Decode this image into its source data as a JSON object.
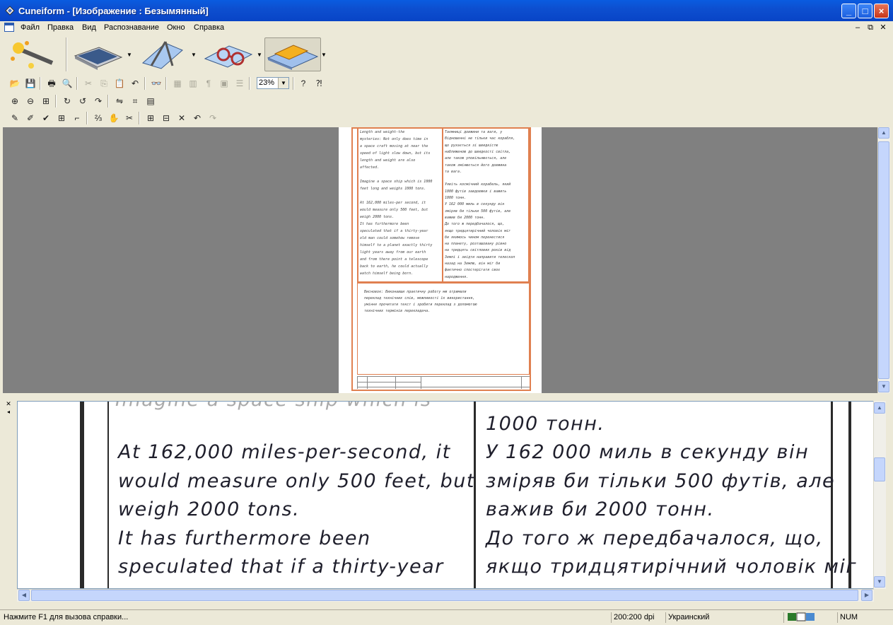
{
  "window": {
    "title": "Cuneiform - [Изображение : Безымянный]"
  },
  "menu": [
    "Файл",
    "Правка",
    "Вид",
    "Распознавание",
    "Окно",
    "Справка"
  ],
  "toolbar": {
    "zoom_value": "23%"
  },
  "preview": {
    "left_col_lines": [
      "Length and weight-the",
      "mysteries: Not only does time in",
      "a space craft moving at near the",
      "speed of light slow down, but its",
      "length and weight are also",
      "affected.",
      "",
      "Imagine a space ship which is 1000",
      "feet long and weighs 1000 tons.",
      "",
      "At 162,000 miles-per second, it",
      "would measure only 500 feet, but",
      "weigh 2000 tons.",
      "It has furthermore been",
      "speculated that if a thirty-year",
      "old man could somehow remove",
      "himself to a planet exactly thirty",
      "light years away from our earth",
      "and from there point a telescope",
      "back to earth, he could actually",
      "watch himself being born."
    ],
    "right_col_lines": [
      "Таємниці довжини та ваги, у",
      "Відношенні не тільки час корабля,",
      "що рухається зі швидкістю",
      "наближеною до швидкості світла,",
      "але також уповільнюється, але",
      "також змінюється його довжина",
      "та вага.",
      "",
      "Уявіть космічний корабель, який",
      "1000 футів завдовжки і важить",
      "1000 тонн.",
      "У 162 000 миль в секунду він",
      "зміряв би тільки 500 футів, але",
      "важив би 2000 тонн.",
      "До того ж передбачалося, що,",
      "якщо тридцятирічний чоловік міг",
      "би якимось чином перенестися",
      "на планету, розташовану рівно",
      "на тридцять світлових років від",
      "Землі і звідти направити телескоп",
      "назад на Землю, він міг би",
      "фактично спостерігати своє",
      "народження."
    ],
    "conclusion_lines": [
      "Висновок: Виконавши практичну роботу ми отримали",
      "переклад технічних слів, можливості їх використання,",
      "уміння прочитати текст і зробити переклад з допомогою",
      "технічних термінів перекладача."
    ]
  },
  "ocr_left": [
    "At 162,000 miles-per-second, it",
    "would measure only 500 feet, but",
    "weigh 2000 tons.",
    "It has furthermore been",
    "speculated that if a thirty-year"
  ],
  "ocr_right_top": "1000 тонн.",
  "ocr_right": [
    "У 162 000 миль в секунду він",
    "зміряв би тільки 500 футів, але",
    "важив би 2000 тонн.",
    "До того ж передбачалося, що,",
    "якщо тридцятирічний чоловік міг"
  ],
  "status": {
    "help": "Нажмите F1 для вызова справки...",
    "dpi": "200:200 dpi",
    "language": "Украинский",
    "num": "NUM"
  },
  "colors": {
    "title_blue": "#0a5ce0",
    "frame_orange": "#e08050"
  }
}
